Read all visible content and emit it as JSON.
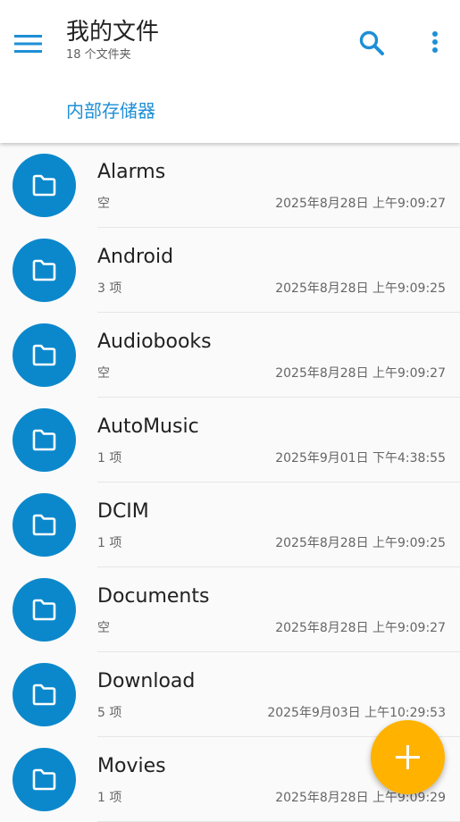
{
  "header": {
    "title": "我的文件",
    "subtitle": "18 个文件夹",
    "breadcrumb": "内部存储器"
  },
  "icons": {
    "menu": "hamburger-menu-icon",
    "search": "search-icon",
    "more": "more-vert-icon",
    "folder": "folder-icon",
    "fab": "plus-icon"
  },
  "colors": {
    "accent": "#1e8fd6",
    "folder_circle": "#0b88cc",
    "fab": "#ffb300"
  },
  "folders": [
    {
      "name": "Alarms",
      "meta": "空",
      "date": "2025年8月28日 上午9:09:27"
    },
    {
      "name": "Android",
      "meta": "3 项",
      "date": "2025年8月28日 上午9:09:25"
    },
    {
      "name": "Audiobooks",
      "meta": "空",
      "date": "2025年8月28日 上午9:09:27"
    },
    {
      "name": "AutoMusic",
      "meta": "1 项",
      "date": "2025年9月01日 下午4:38:55"
    },
    {
      "name": "DCIM",
      "meta": "1 项",
      "date": "2025年8月28日 上午9:09:25"
    },
    {
      "name": "Documents",
      "meta": "空",
      "date": "2025年8月28日 上午9:09:27"
    },
    {
      "name": "Download",
      "meta": "5 项",
      "date": "2025年9月03日 上午10:29:53"
    },
    {
      "name": "Movies",
      "meta": "1 项",
      "date": "2025年8月28日 上午9:09:29"
    }
  ]
}
